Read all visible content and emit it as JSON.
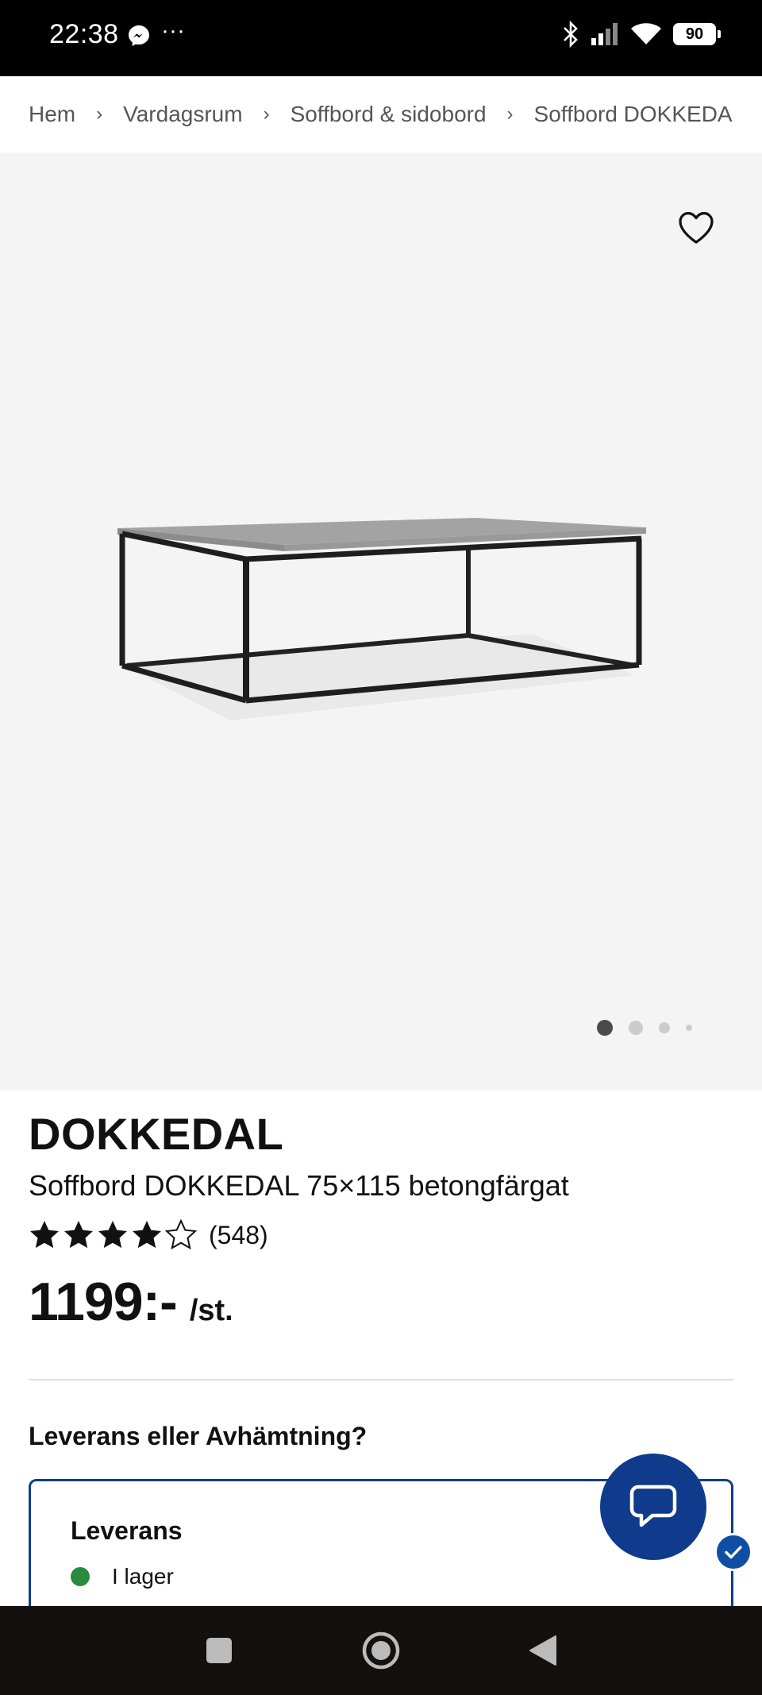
{
  "status_bar": {
    "time": "22:38",
    "dots": "···",
    "battery": "90",
    "icons": [
      "messenger-icon",
      "bluetooth-icon",
      "signal-icon",
      "wifi-icon",
      "battery-icon"
    ]
  },
  "breadcrumb": {
    "items": [
      "Hem",
      "Vardagsrum",
      "Soffbord & sidobord",
      "Soffbord DOKKEDAL"
    ]
  },
  "gallery": {
    "image_count": 4,
    "active_index": 0
  },
  "product": {
    "name": "DOKKEDAL",
    "description": "Soffbord DOKKEDAL 75×115 betongfärgat",
    "rating": 4,
    "rating_max": 5,
    "review_count": "(548)",
    "price": "1199:-",
    "price_unit": "/st."
  },
  "delivery": {
    "question": "Leverans eller Avhämtning?",
    "option_title": "Leverans",
    "stock_status": "I lager",
    "stock_color": "#2a8a3e"
  },
  "colors": {
    "accent": "#0f3f8c",
    "chat_fab": "#103b8c"
  },
  "nav": {
    "icons": [
      "recents-icon",
      "home-icon",
      "back-icon"
    ]
  }
}
